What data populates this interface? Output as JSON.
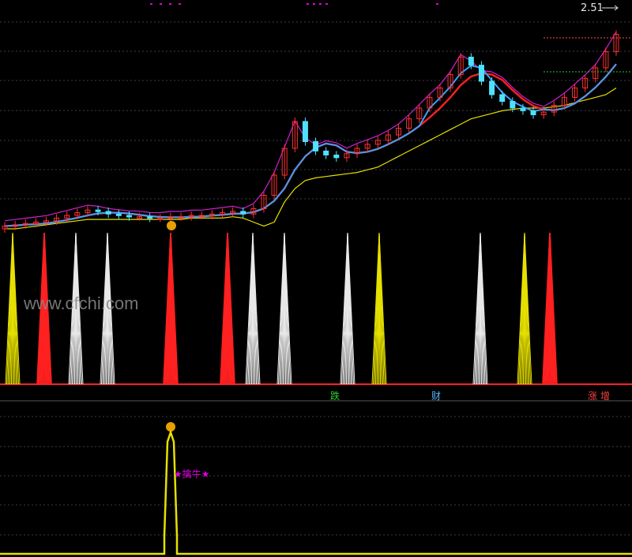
{
  "watermark": "www.cfchi.com",
  "price_label": "2.51",
  "mid_labels": [
    {
      "text": "跌",
      "color": "#2fd12f"
    },
    {
      "text": "财",
      "color": "#5ab7ff"
    },
    {
      "text": "涨",
      "color": "#ff4040"
    },
    {
      "text": "增",
      "color": "#ff4040"
    }
  ],
  "signal_label": "★擒牛★",
  "colors": {
    "up": "#ff3030",
    "down": "#50e0ff",
    "ma_fast": "#3aa0ff",
    "ma_red": "#ff2020",
    "ma_yellow": "#e6e000",
    "band": "#d020d0",
    "spike_yellow": "#e6e000",
    "spike_red": "#ff2020",
    "spike_white": "#e8e8e8"
  },
  "chart_data": [
    {
      "type": "candlestick",
      "title": "",
      "candles_close_open": [
        [
          1.02,
          1.0
        ],
        [
          1.03,
          1.02
        ],
        [
          1.04,
          1.03
        ],
        [
          1.05,
          1.04
        ],
        [
          1.06,
          1.05
        ],
        [
          1.08,
          1.06
        ],
        [
          1.1,
          1.08
        ],
        [
          1.12,
          1.1
        ],
        [
          1.14,
          1.12
        ],
        [
          1.13,
          1.14
        ],
        [
          1.11,
          1.13
        ],
        [
          1.1,
          1.11
        ],
        [
          1.09,
          1.1
        ],
        [
          1.09,
          1.09
        ],
        [
          1.08,
          1.09
        ],
        [
          1.08,
          1.08
        ],
        [
          1.09,
          1.08
        ],
        [
          1.09,
          1.09
        ],
        [
          1.1,
          1.09
        ],
        [
          1.1,
          1.1
        ],
        [
          1.11,
          1.1
        ],
        [
          1.12,
          1.11
        ],
        [
          1.13,
          1.12
        ],
        [
          1.11,
          1.13
        ],
        [
          1.15,
          1.11
        ],
        [
          1.25,
          1.15
        ],
        [
          1.4,
          1.25
        ],
        [
          1.6,
          1.4
        ],
        [
          1.8,
          1.6
        ],
        [
          1.65,
          1.8
        ],
        [
          1.58,
          1.65
        ],
        [
          1.55,
          1.58
        ],
        [
          1.53,
          1.55
        ],
        [
          1.56,
          1.53
        ],
        [
          1.6,
          1.56
        ],
        [
          1.63,
          1.6
        ],
        [
          1.66,
          1.63
        ],
        [
          1.7,
          1.66
        ],
        [
          1.75,
          1.7
        ],
        [
          1.82,
          1.75
        ],
        [
          1.9,
          1.82
        ],
        [
          1.98,
          1.9
        ],
        [
          2.05,
          1.98
        ],
        [
          2.15,
          2.05
        ],
        [
          2.28,
          2.15
        ],
        [
          2.22,
          2.28
        ],
        [
          2.1,
          2.22
        ],
        [
          2.0,
          2.1
        ],
        [
          1.95,
          2.0
        ],
        [
          1.9,
          1.95
        ],
        [
          1.88,
          1.9
        ],
        [
          1.85,
          1.88
        ],
        [
          1.87,
          1.85
        ],
        [
          1.92,
          1.87
        ],
        [
          1.98,
          1.92
        ],
        [
          2.05,
          1.98
        ],
        [
          2.12,
          2.05
        ],
        [
          2.2,
          2.12
        ],
        [
          2.32,
          2.2
        ],
        [
          2.45,
          2.32
        ]
      ],
      "ma_yellow": [
        1.0,
        1.0,
        1.01,
        1.02,
        1.03,
        1.04,
        1.05,
        1.06,
        1.07,
        1.07,
        1.07,
        1.07,
        1.07,
        1.07,
        1.07,
        1.07,
        1.07,
        1.07,
        1.08,
        1.08,
        1.08,
        1.08,
        1.09,
        1.08,
        1.05,
        1.02,
        1.05,
        1.2,
        1.3,
        1.36,
        1.38,
        1.39,
        1.4,
        1.41,
        1.42,
        1.44,
        1.46,
        1.5,
        1.54,
        1.58,
        1.62,
        1.66,
        1.7,
        1.74,
        1.78,
        1.82,
        1.84,
        1.86,
        1.88,
        1.89,
        1.9,
        1.9,
        1.9,
        1.91,
        1.92,
        1.94,
        1.96,
        1.98,
        2.0,
        2.05
      ]
    },
    {
      "type": "bar",
      "title": "",
      "spikes": [
        {
          "x": 0.02,
          "color": "yellow"
        },
        {
          "x": 0.07,
          "color": "red"
        },
        {
          "x": 0.12,
          "color": "white"
        },
        {
          "x": 0.17,
          "color": "white"
        },
        {
          "x": 0.27,
          "color": "red"
        },
        {
          "x": 0.36,
          "color": "red"
        },
        {
          "x": 0.4,
          "color": "white"
        },
        {
          "x": 0.45,
          "color": "white"
        },
        {
          "x": 0.55,
          "color": "white"
        },
        {
          "x": 0.6,
          "color": "yellow"
        },
        {
          "x": 0.76,
          "color": "white"
        },
        {
          "x": 0.83,
          "color": "yellow"
        },
        {
          "x": 0.87,
          "color": "red"
        }
      ]
    },
    {
      "type": "line",
      "title": "",
      "signal_peaks": [
        {
          "x": 0.27,
          "value": 1
        }
      ]
    }
  ]
}
